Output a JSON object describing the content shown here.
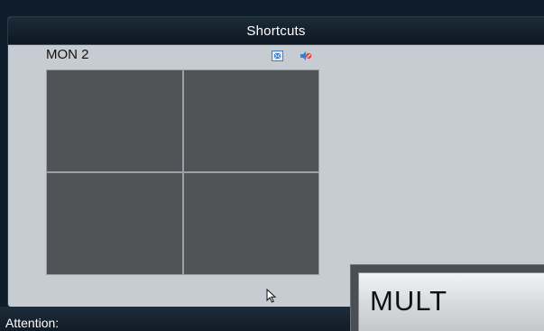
{
  "dialog": {
    "title": "Shortcuts",
    "monitor_label": "MON 2",
    "icons": {
      "fullscreen": "fullscreen-icon",
      "mute": "speaker-muted-icon"
    },
    "grid": {
      "rows": 2,
      "columns": 2
    }
  },
  "status": {
    "attention_label": "Attention:"
  },
  "mult_button": {
    "label": "MULT"
  },
  "colors": {
    "header": "#0c1722",
    "dialog_bg": "#c7ccd2",
    "video_cell": "#505457",
    "accent_blue": "#3b7fd0"
  }
}
